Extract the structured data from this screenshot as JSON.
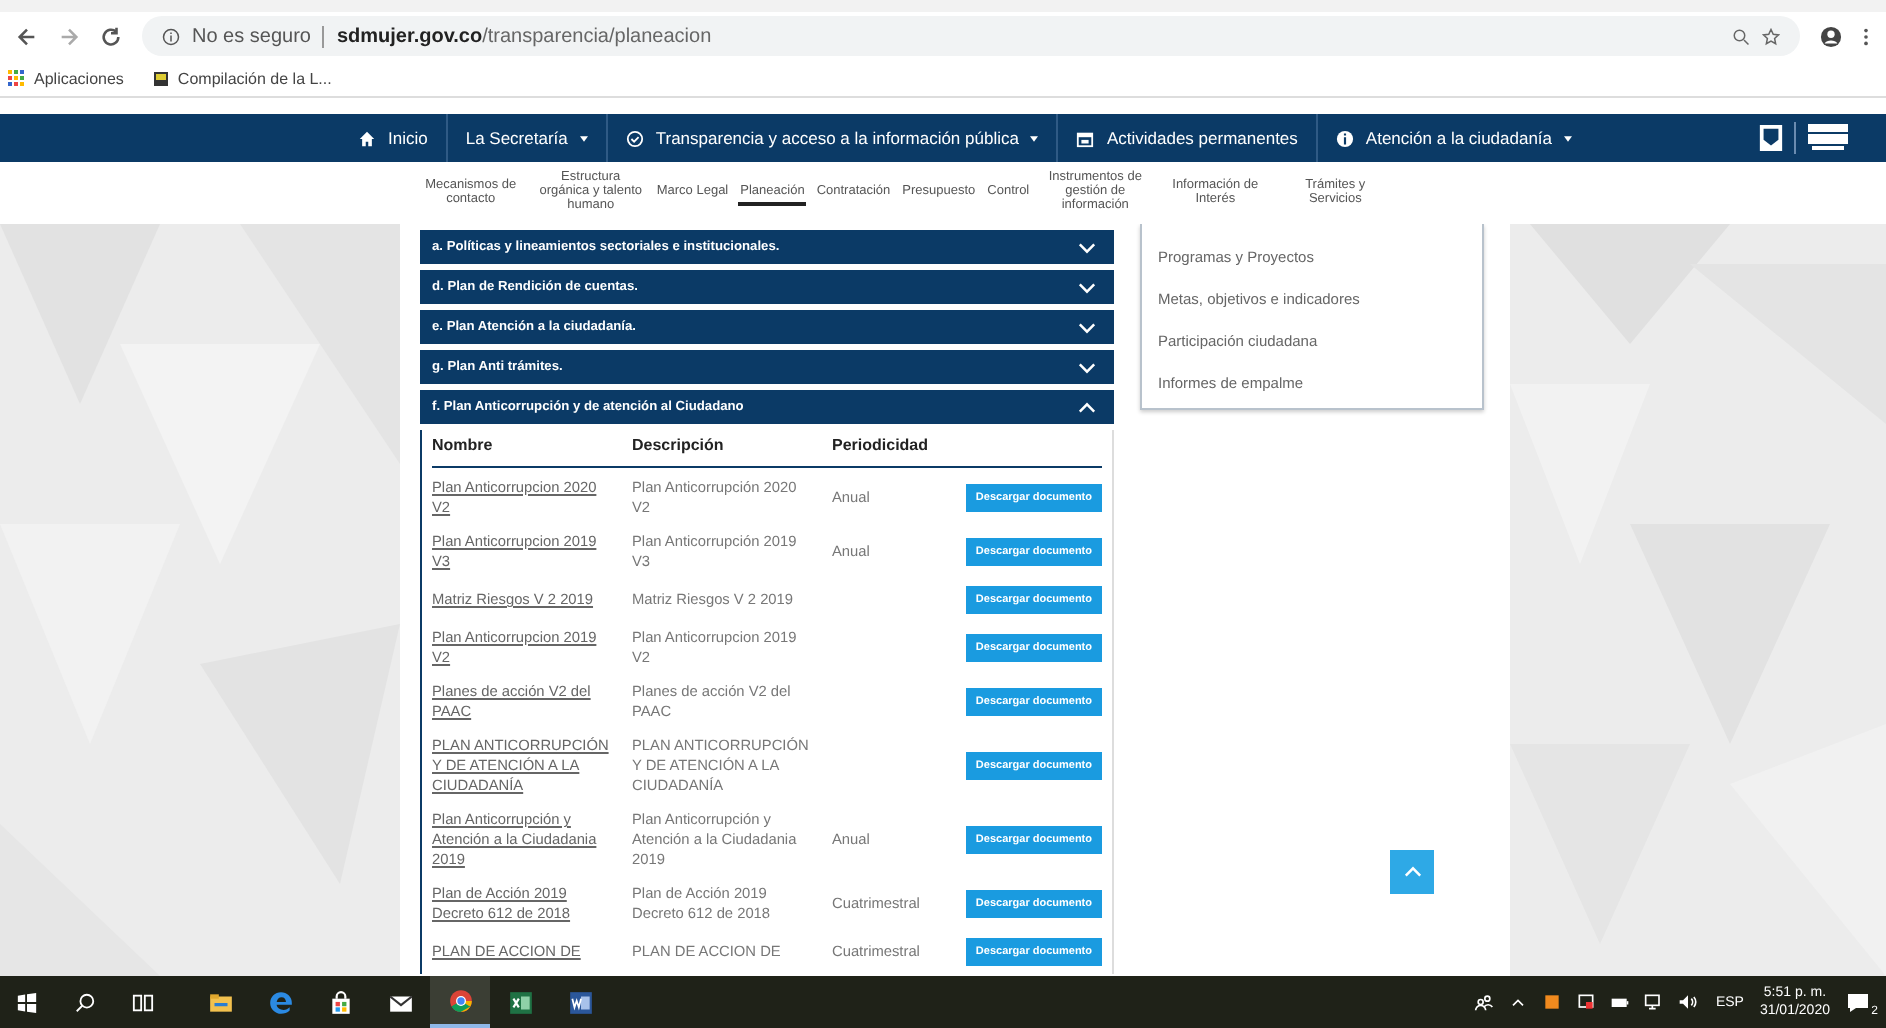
{
  "browser": {
    "security": "No es seguro",
    "url": "**sdmujer.gov.co**/transparencia/planeacion"
  },
  "bookmarks": [
    {
      "label": "Aplicaciones",
      "kind": "apps"
    },
    {
      "label": "Compilación de la L...",
      "kind": "page"
    }
  ],
  "nav": [
    {
      "label": "Inicio",
      "kind": "home",
      "dropdown": false
    },
    {
      "label": "La Secretaría",
      "kind": "plain",
      "dropdown": true
    },
    {
      "label": "Transparencia y acceso a la información pública",
      "kind": "check",
      "dropdown": true
    },
    {
      "label": "Actividades permanentes",
      "kind": "calendar",
      "dropdown": false
    },
    {
      "label": "Atención a la ciudadanía",
      "kind": "info",
      "dropdown": true
    }
  ],
  "submenu": [
    {
      "label": "Mecanismos de contacto",
      "selected": false
    },
    {
      "label": "Estructura orgánica y talento humano",
      "selected": false
    },
    {
      "label": "Marco Legal",
      "selected": false
    },
    {
      "label": "Planeación",
      "selected": true
    },
    {
      "label": "Contratación",
      "selected": false
    },
    {
      "label": "Presupuesto",
      "selected": false
    },
    {
      "label": "Control",
      "selected": false
    },
    {
      "label": "Instrumentos de gestión de información",
      "selected": false
    },
    {
      "label": "Información de Interés",
      "selected": false
    },
    {
      "label": "Trámites y Servicios",
      "selected": false
    }
  ],
  "sections": [
    {
      "title": "a. Políticas y lineamientos sectoriales e institucionales.",
      "expanded": false
    },
    {
      "title": "d. Plan de Rendición de cuentas.",
      "expanded": false
    },
    {
      "title": "e. Plan Atención a la ciudadanía.",
      "expanded": false
    },
    {
      "title": "g. Plan Anti trámites.",
      "expanded": false
    },
    {
      "title": "f. Plan Anticorrupción y de atención al Ciudadano",
      "expanded": true,
      "table": {
        "columns": [
          "Nombre",
          "Descripción",
          "Periodicidad"
        ],
        "rows": [
          {
            "name": "Plan Anticorrupcion 2020 V2",
            "description": "Plan Anticorrupción 2020 V2",
            "periodicity": "Anual",
            "button": "Descargar documento"
          },
          {
            "name": "Plan Anticorrupcion 2019 V3",
            "description": "Plan Anticorrupción 2019 V3",
            "periodicity": "Anual",
            "button": "Descargar documento"
          },
          {
            "name": "Matriz Riesgos V 2 2019",
            "description": "Matriz Riesgos V 2 2019",
            "button": "Descargar documento"
          },
          {
            "name": "Plan Anticorrupcion 2019 V2",
            "description": "Plan Anticorrupcion 2019 V2",
            "button": "Descargar documento"
          },
          {
            "name": "Planes de acción V2 del PAAC",
            "description": "Planes de acción V2 del PAAC",
            "button": "Descargar documento"
          },
          {
            "name": "PLAN ANTICORRUPCIÓN Y DE ATENCIÓN A LA CIUDADANÍA",
            "description": "PLAN ANTICORRUPCIÓN Y DE ATENCIÓN A LA CIUDADANÍA",
            "button": "Descargar documento"
          },
          {
            "name": "Plan Anticorrupción y Atención a la Ciudadania 2019",
            "description": "Plan Anticorrupción y Atención a la Ciudadania 2019",
            "periodicity": "Anual",
            "button": "Descargar documento"
          },
          {
            "name": "Plan de Acción 2019 Decreto 612 de 2018",
            "description": "Plan de Acción 2019 Decreto 612 de 2018",
            "periodicity": "Cuatrimestral",
            "button": "Descargar documento"
          },
          {
            "name": "PLAN DE ACCION DE",
            "description": "PLAN DE ACCION DE",
            "periodicity": "Cuatrimestral",
            "button": "Descargar documento"
          }
        ]
      }
    }
  ],
  "side_menu": [
    "Programas y Proyectos",
    "Metas, objetivos e indicadores",
    "Participación ciudadana",
    "Informes de empalme"
  ],
  "taskbar": {
    "apps": [
      {
        "kind": "explorer",
        "active": false
      },
      {
        "kind": "edge",
        "active": false
      },
      {
        "kind": "store",
        "active": false
      },
      {
        "kind": "mail",
        "active": false
      },
      {
        "kind": "chrome",
        "active": true
      },
      {
        "kind": "excel",
        "active": false
      },
      {
        "kind": "word",
        "active": false
      }
    ],
    "language": "ESP",
    "time": "5:51 p. m.",
    "date": "31/01/2020",
    "notifications": "2"
  }
}
